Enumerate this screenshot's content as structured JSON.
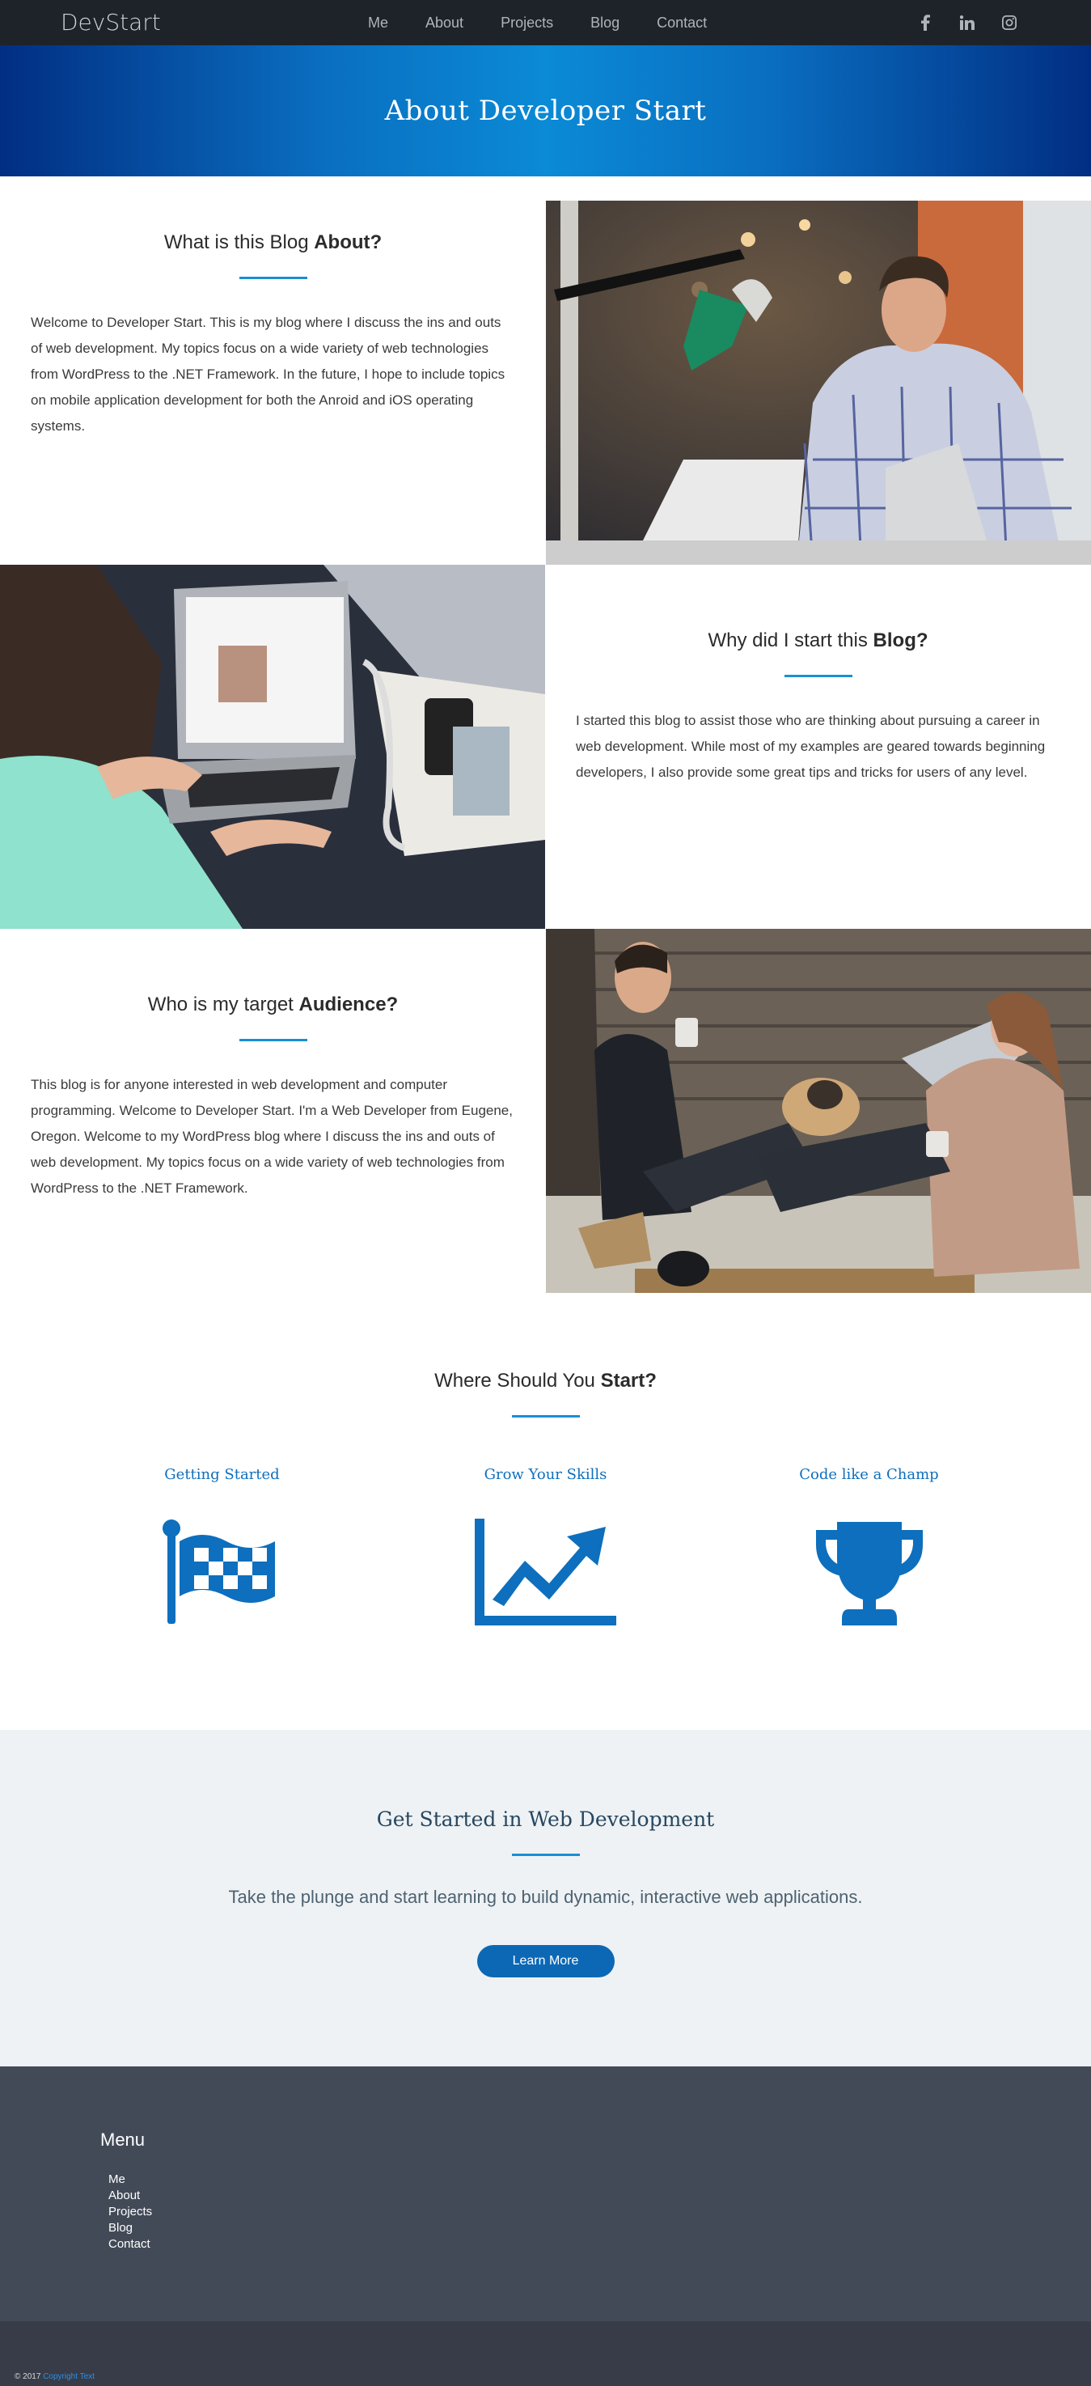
{
  "nav": {
    "brand": "DevStart",
    "links": [
      "Me",
      "About",
      "Projects",
      "Blog",
      "Contact"
    ],
    "social": [
      "facebook-icon",
      "linkedin-icon",
      "instagram-icon"
    ]
  },
  "hero": {
    "title": "About Developer Start"
  },
  "sections": [
    {
      "heading": "What is this Blog",
      "heading_bold": "About?",
      "body": "Welcome to Developer Start. This is my blog where I discuss the ins and outs of web development. My topics focus on a wide variety of web technologies from WordPress to the .NET Framework. In the future, I hope to include topics on mobile application development for both the Anroid and iOS operating systems."
    },
    {
      "heading": "Why did I start this",
      "heading_bold": "Blog?",
      "body": "I started this blog to assist those who are thinking about pursuing a career in web development. While most of my examples are geared towards beginning developers, I also provide some great tips and tricks for users of any level."
    },
    {
      "heading": "Who is my target",
      "heading_bold": "Audience?",
      "body": "This blog is for anyone interested in web development and computer programming. Welcome to Developer Start. I'm a Web Developer from Eugene, Oregon. Welcome to my WordPress blog where I discuss the ins and outs of web development. My topics focus on a wide variety of web technologies from WordPress to the .NET Framework."
    }
  ],
  "where": {
    "heading": "Where Should You",
    "heading_bold": "Start?",
    "cards": [
      {
        "title": "Getting Started",
        "icon": "flag-icon"
      },
      {
        "title": "Grow Your Skills",
        "icon": "chart-up-icon"
      },
      {
        "title": "Code like a Champ",
        "icon": "trophy-icon"
      }
    ]
  },
  "cta": {
    "heading": "Get Started in Web Development",
    "text": "Take the plunge and start learning to build dynamic, interactive web applications.",
    "button": "Learn More"
  },
  "footer": {
    "menu_title": "Menu",
    "menu": [
      "Me",
      "About",
      "Projects",
      "Blog",
      "Contact"
    ],
    "copyright": "© 2017",
    "copyright_link": "Copyright Text"
  },
  "colors": {
    "accent": "#1a8fd3",
    "brand_blue": "#0d6fbd",
    "nav_bg": "#1e2329",
    "footer_bg": "#434a57"
  }
}
